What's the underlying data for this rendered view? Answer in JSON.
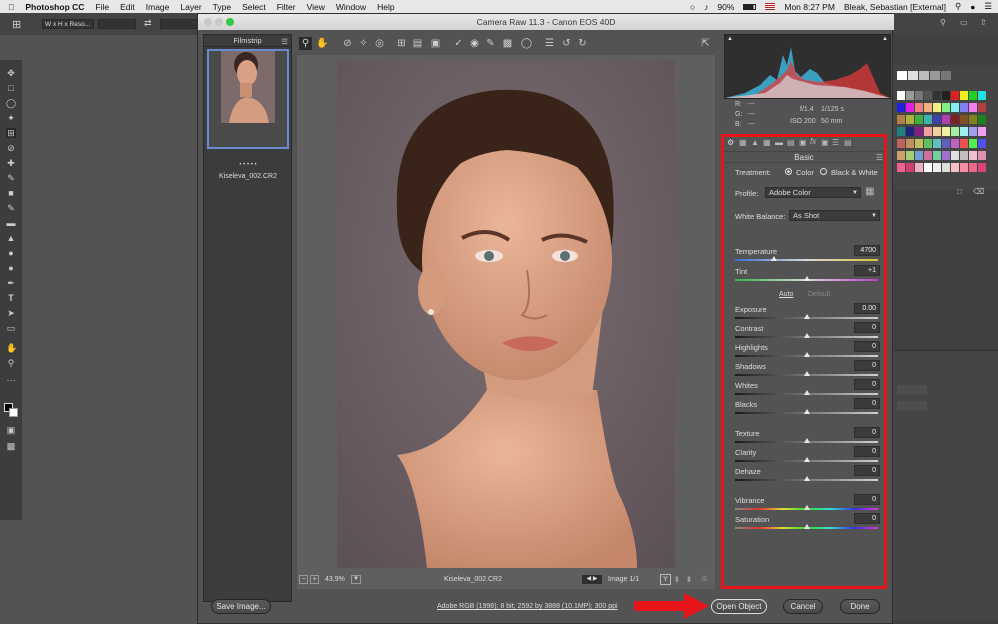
{
  "menubar": {
    "app": "Photoshop CC",
    "menus": [
      "File",
      "Edit",
      "Image",
      "Layer",
      "Type",
      "Select",
      "Filter",
      "View",
      "Window",
      "Help"
    ],
    "battery": "90%",
    "clock": "Mon 8:27 PM",
    "user": "Bleak, Sebastian [External]"
  },
  "options_bar": {
    "ratio": "W x H x Reso..."
  },
  "dialog": {
    "title": "Camera Raw 11.3  -  Canon EOS 40D",
    "filmstrip_label": "Filmstrip",
    "thumb_name": "Kiseleva_002.CR2",
    "thumb_dots": "• • • • •",
    "zoom": "43.9%",
    "filename": "Kiseleva_002.CR2",
    "image_counter": "Image 1/1",
    "workflow_link": "Adobe RGB (1998); 8 bit; 2592 by 3888 (10.1MP); 300 ppi",
    "buttons": {
      "save": "Save Image...",
      "open": "Open Object",
      "cancel": "Cancel",
      "done": "Done"
    }
  },
  "readout": {
    "r": "R:",
    "g": "G:",
    "b": "B:",
    "r_val": "---",
    "g_val": "---",
    "b_val": "---",
    "aperture": "f/1.4",
    "shutter": "1/125 s",
    "iso": "ISO 200",
    "focal": "50 mm"
  },
  "basic": {
    "panel_title": "Basic",
    "treatment_label": "Treatment:",
    "treatment_color": "Color",
    "treatment_bw": "Black & White",
    "profile_label": "Profile:",
    "profile_value": "Adobe Color",
    "wb_label": "White Balance:",
    "wb_value": "As Shot",
    "auto": "Auto",
    "default": "Default",
    "sliders": [
      {
        "label": "Temperature",
        "value": "4700",
        "pos": 0.27,
        "track": "temp"
      },
      {
        "label": "Tint",
        "value": "+1",
        "pos": 0.5,
        "track": "tint"
      },
      {
        "label": "Exposure",
        "value": "0.00",
        "pos": 0.5,
        "track": "plain"
      },
      {
        "label": "Contrast",
        "value": "0",
        "pos": 0.5,
        "track": "plain"
      },
      {
        "label": "Highlights",
        "value": "0",
        "pos": 0.5,
        "track": "plain"
      },
      {
        "label": "Shadows",
        "value": "0",
        "pos": 0.5,
        "track": "plain"
      },
      {
        "label": "Whites",
        "value": "0",
        "pos": 0.5,
        "track": "plain"
      },
      {
        "label": "Blacks",
        "value": "0",
        "pos": 0.5,
        "track": "plain"
      },
      {
        "label": "Texture",
        "value": "0",
        "pos": 0.5,
        "track": "plain"
      },
      {
        "label": "Clarity",
        "value": "0",
        "pos": 0.5,
        "track": "plain"
      },
      {
        "label": "Dehaze",
        "value": "0",
        "pos": 0.5,
        "track": "plain"
      },
      {
        "label": "Vibrance",
        "value": "0",
        "pos": 0.5,
        "track": "vib"
      },
      {
        "label": "Saturation",
        "value": "0",
        "pos": 0.5,
        "track": "sat"
      }
    ]
  }
}
